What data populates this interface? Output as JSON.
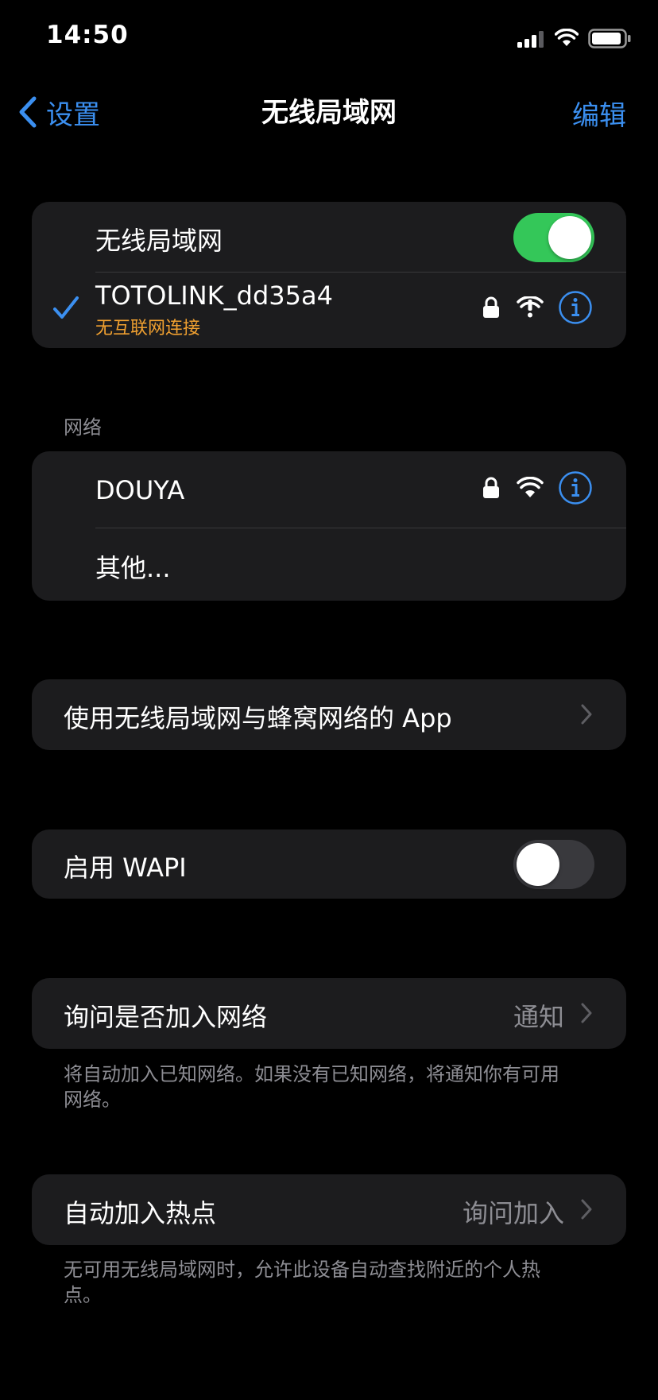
{
  "status_bar": {
    "time": "14:50"
  },
  "nav": {
    "back_label": "设置",
    "title": "无线局域网",
    "edit_label": "编辑"
  },
  "wifi_group": {
    "wifi_label": "无线局域网",
    "wifi_enabled": true,
    "connected_network": {
      "name": "TOTOLINK_dd35a4",
      "status": "无互联网连接",
      "status_color": "#f0a030",
      "secured": true,
      "no_internet": true
    }
  },
  "networks_section": {
    "header": "网络",
    "items": [
      {
        "name": "DOUYA",
        "secured": true
      },
      {
        "name": "其他..."
      }
    ]
  },
  "apps_row": {
    "label": "使用无线局域网与蜂窝网络的 App"
  },
  "wapi_row": {
    "label": "启用 WAPI",
    "enabled": false
  },
  "ask_join_row": {
    "label": "询问是否加入网络",
    "value": "通知",
    "footer": "将自动加入已知网络。如果没有已知网络，将通知你有可用网络。"
  },
  "hotspot_row": {
    "label": "自动加入热点",
    "value": "询问加入",
    "footer": "无可用无线局域网时，允许此设备自动查找附近的个人热点。"
  },
  "colors": {
    "accent": "#3b8ff0",
    "toggle_on": "#34c759",
    "warning": "#f0a030",
    "background": "#000000",
    "cell": "#1c1c1e"
  }
}
